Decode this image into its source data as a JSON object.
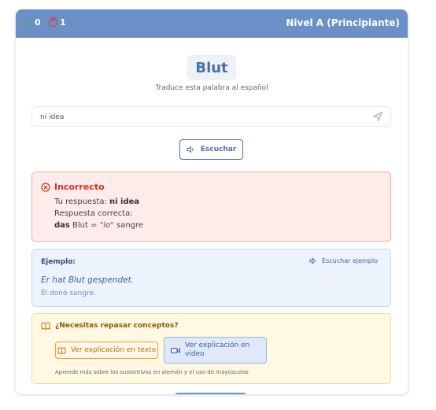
{
  "header": {
    "correct_count": "0",
    "wrong_count": "1",
    "level": "Nivel A (Principiante)"
  },
  "word": "Blut",
  "instruction": "Traduce esta palabra al español",
  "answer": {
    "value": "ni idea",
    "placeholder": ""
  },
  "listen_label": "Escuchar",
  "result": {
    "title": "Incorrecto",
    "your_answer_label": "Tu respuesta:",
    "your_answer": "ni idea",
    "correct_label": "Respuesta correcta:",
    "article": "das",
    "noun": "Blut =",
    "translation": "\"lo\"",
    "meaning": "sangre"
  },
  "example": {
    "label": "Ejemplo:",
    "audio_label": "Escuchar ejemplo",
    "sentence": "Er hat Blut gespendet.",
    "translation": "Él donó sangre."
  },
  "review": {
    "title": "¿Necesitas repasar conceptos?",
    "text_button": "Ver explicación en texto",
    "video_button": "Ver explicación en video",
    "footnote": "Aprende más sobre los sustantivos en alemán y el uso de mayúsculas"
  },
  "colors": {
    "header_bg": "#6b8fc7",
    "accent_blue": "#4a6fa8",
    "error_red": "#d93025",
    "success_green": "#4caf50",
    "warning_orange": "#e8a33a"
  },
  "icons": {
    "correct": "check-circle-icon",
    "wrong": "x-circle-icon",
    "send": "send-icon",
    "speaker": "speaker-icon",
    "book": "book-icon",
    "video": "video-icon"
  }
}
